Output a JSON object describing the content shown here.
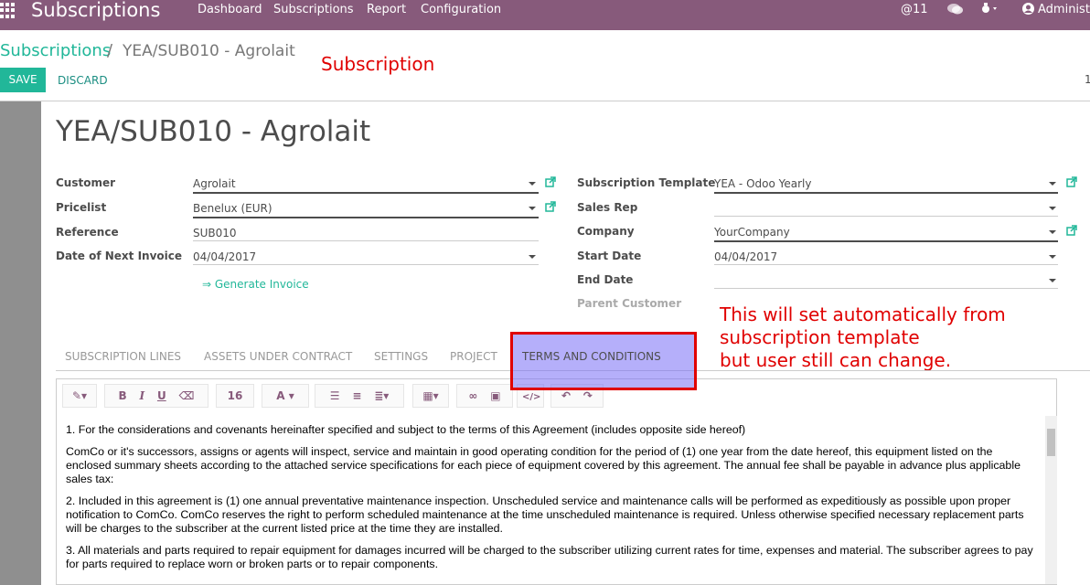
{
  "topbar": {
    "app_title": "Subscriptions",
    "menu": [
      "Dashboard",
      "Subscriptions",
      "Report",
      "Configuration"
    ],
    "mentions": "@11",
    "user": "Administ"
  },
  "breadcrumb": {
    "parent": "Subscriptions",
    "current": "YEA/SUB010 - Agrolait"
  },
  "actions": {
    "save": "SAVE",
    "discard": "DISCARD"
  },
  "annotations": {
    "header_note": "Subscription",
    "note_line1": "This will set automatically from",
    "note_line2": "subscription template",
    "note_line3": "but user still can change."
  },
  "record": {
    "title": "YEA/SUB010 - Agrolait"
  },
  "left_fields": {
    "customer_label": "Customer",
    "customer_value": "Agrolait",
    "pricelist_label": "Pricelist",
    "pricelist_value": "Benelux (EUR)",
    "reference_label": "Reference",
    "reference_value": "SUB010",
    "next_invoice_label": "Date of Next Invoice",
    "next_invoice_value": "04/04/2017",
    "generate_invoice": "⇒ Generate Invoice"
  },
  "right_fields": {
    "template_label": "Subscription Template",
    "template_value": "YEA - Odoo Yearly",
    "sales_rep_label": "Sales Rep",
    "sales_rep_value": "",
    "company_label": "Company",
    "company_value": "YourCompany",
    "start_date_label": "Start Date",
    "start_date_value": "04/04/2017",
    "end_date_label": "End Date",
    "end_date_value": "",
    "parent_customer_label": "Parent Customer"
  },
  "tabs": [
    "SUBSCRIPTION LINES",
    "ASSETS UNDER CONTRACT",
    "SETTINGS",
    "PROJECT",
    "TERMS AND CONDITIONS"
  ],
  "toolbar": {
    "font_size": "16"
  },
  "terms": [
    "1. For the considerations and covenants hereinafter specified and subject to the terms of this Agreement (includes opposite side hereof)",
    "ComCo or it's successors, assigns or agents will inspect, service and maintain in good operating condition for the period of (1) one year from the date hereof, this equipment listed on the enclosed summary sheets according to the attached service specifications for each piece of equipment covered by this agreement. The annual fee shall be payable in advance plus applicable sales tax:",
    "2. Included in this agreement is (1) one annual preventative maintenance inspection. Unscheduled service and maintenance calls will be performed as expeditiously as possible upon proper notification to ComCo. ComCo reserves the right to perform scheduled maintenance at the time unscheduled maintenance is required. Unless otherwise specified necessary replacement parts will be charges to the subscriber at the current listed price at the time they are installed.",
    "3. All materials and parts required to repair equipment for damages incurred will be charged to the subscriber utilizing current rates for time, expenses and material. The subscriber agrees to pay for parts required to replace worn or broken parts or to repair components."
  ]
}
